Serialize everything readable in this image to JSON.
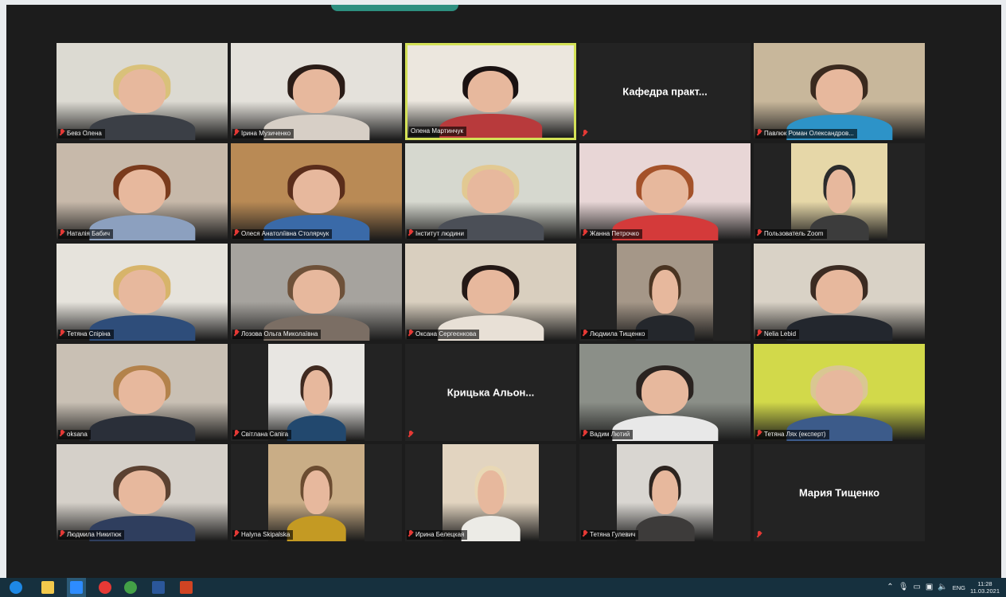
{
  "meeting": {
    "participants": [
      {
        "name": "Бевз Олена",
        "muted": true,
        "video": true,
        "bg": "#dcdad2",
        "hair": "#d9c17a",
        "shirt": "#3b3f46"
      },
      {
        "name": "Ірина Музиченко",
        "muted": true,
        "video": true,
        "bg": "#e4e1db",
        "hair": "#2a1c17",
        "shirt": "#d7cfc6"
      },
      {
        "name": "Олена Мартинчук",
        "muted": false,
        "video": true,
        "active": true,
        "bg": "#ece7de",
        "hair": "#1a1212",
        "shirt": "#b83a3c"
      },
      {
        "name": "",
        "display_name": "Кафедра практ...",
        "muted": true,
        "video": false
      },
      {
        "name": "Павлюк Роман Олександров...",
        "muted": true,
        "video": true,
        "bg": "#c8b79b",
        "hair": "#3a2a1f",
        "shirt": "#2d93c8"
      },
      {
        "name": "Наталія Бабич",
        "muted": true,
        "video": true,
        "bg": "#c7b9aa",
        "hair": "#7a3b1d",
        "shirt": "#8ca0bf"
      },
      {
        "name": "Олеся Анатоліївна Столярчук",
        "muted": true,
        "video": true,
        "bg": "#b98a55",
        "hair": "#5a2d1b",
        "shirt": "#3a6aa8"
      },
      {
        "name": "Інститут людини",
        "muted": true,
        "video": true,
        "bg": "#d6d8cf",
        "hair": "#e2c992",
        "shirt": "#4b4f57"
      },
      {
        "name": "Жанна Петрочко",
        "muted": true,
        "video": true,
        "bg": "#e8d6d6",
        "hair": "#a4522a",
        "shirt": "#d43a3a"
      },
      {
        "name": "Пользователь Zoom",
        "muted": true,
        "video": true,
        "narrow": true,
        "bg": "#e6d7a8",
        "hair": "#2b2b2b",
        "shirt": "#3c3c3c"
      },
      {
        "name": "Тетяна Спіріна",
        "muted": true,
        "video": true,
        "bg": "#e6e3dc",
        "hair": "#d7b46a",
        "shirt": "#2e4d7a"
      },
      {
        "name": "Лозова Ольга Миколаївна",
        "muted": true,
        "video": true,
        "bg": "#a6a39e",
        "hair": "#6e5139",
        "shirt": "#7b6e64"
      },
      {
        "name": "Оксана Сергеєнкова",
        "muted": true,
        "video": true,
        "bg": "#d9cfbf",
        "hair": "#231815",
        "shirt": "#e8e0d6"
      },
      {
        "name": "Людмила Тищенко",
        "muted": true,
        "video": true,
        "narrow": true,
        "bg": "#a59788",
        "hair": "#4a3422",
        "shirt": "#24272c"
      },
      {
        "name": "Nelia Lebid",
        "muted": true,
        "video": true,
        "bg": "#d9d2c6",
        "hair": "#3b2b22",
        "shirt": "#23272e"
      },
      {
        "name": "oksana",
        "muted": true,
        "video": true,
        "bg": "#c9c0b4",
        "hair": "#b3824b",
        "shirt": "#2a2f39"
      },
      {
        "name": "Світлана Сапіга",
        "muted": true,
        "video": true,
        "narrow": true,
        "bg": "#e8e6e2",
        "hair": "#402a20",
        "shirt": "#22486e"
      },
      {
        "name": "",
        "display_name": "Крицька Альон...",
        "muted": true,
        "video": false
      },
      {
        "name": "Вадим Лютий",
        "muted": true,
        "video": true,
        "bg": "#8b8f88",
        "hair": "#2a2320",
        "shirt": "#e8e8e8"
      },
      {
        "name": "Тетяна Лях (експерт)",
        "muted": true,
        "video": true,
        "bg": "#d2d94a",
        "hair": "#d9c792",
        "shirt": "#3c5b8a"
      },
      {
        "name": "Людмила Никитюк",
        "muted": true,
        "video": true,
        "bg": "#d5d0c9",
        "hair": "#5b4131",
        "shirt": "#2f3e5e"
      },
      {
        "name": "Halyna Skipalska",
        "muted": true,
        "video": true,
        "narrow": true,
        "bg": "#c9ad86",
        "hair": "#6b4c31",
        "shirt": "#c49a23"
      },
      {
        "name": "Ирина Белецкая",
        "muted": true,
        "video": true,
        "narrow": true,
        "bg": "#e2d4c0",
        "hair": "#e9d8b5",
        "shirt": "#ecebe6"
      },
      {
        "name": "Тетяна Гулевич",
        "muted": true,
        "video": true,
        "narrow": true,
        "bg": "#d9d6d1",
        "hair": "#2d241f",
        "shirt": "#3d3b3a"
      },
      {
        "name": "",
        "display_name": "Мария Тищенко",
        "muted": true,
        "video": false
      }
    ]
  },
  "taskbar": {
    "apps": [
      {
        "name": "edge-icon",
        "color": "#1e88e5"
      },
      {
        "name": "file-explorer-icon",
        "color": "#f2c94c"
      },
      {
        "name": "zoom-icon",
        "color": "#2d8cff"
      },
      {
        "name": "opera-icon",
        "color": "#e53935"
      },
      {
        "name": "chrome-icon",
        "color": "#43a047"
      },
      {
        "name": "word-icon",
        "color": "#2b579a"
      },
      {
        "name": "powerpoint-icon",
        "color": "#d04423"
      }
    ],
    "language": "ENG",
    "time": "11:28",
    "date": "11.03.2021"
  }
}
